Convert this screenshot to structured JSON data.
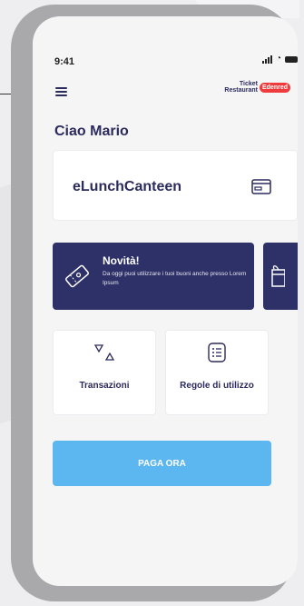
{
  "status_bar": {
    "time": "9:41"
  },
  "header": {
    "logo_line1": "Ticket",
    "logo_line2": "Restaurant",
    "logo_badge": "Edenred"
  },
  "greeting": "Ciao Mario",
  "canteen_card": {
    "name": "eLunchCanteen",
    "icon": "credit-card-icon"
  },
  "promo": {
    "title": "Novità!",
    "text": "Da oggi puoi utilizzare i tuoi buoni anche presso Lorem Ipsum",
    "icon": "ticket-icon"
  },
  "promo_next": {
    "icon": "gift-icon"
  },
  "tiles": [
    {
      "label": "Transazioni",
      "icon": "transactions-icon"
    },
    {
      "label": "Regole di utilizzo",
      "icon": "rules-list-icon"
    }
  ],
  "pay_button": {
    "label": "PAGA ORA"
  },
  "colors": {
    "primary": "#2e3168",
    "accent": "#5cb6f0",
    "brand_red": "#ef3b3b",
    "phone_frame": "#a9a9ab"
  }
}
